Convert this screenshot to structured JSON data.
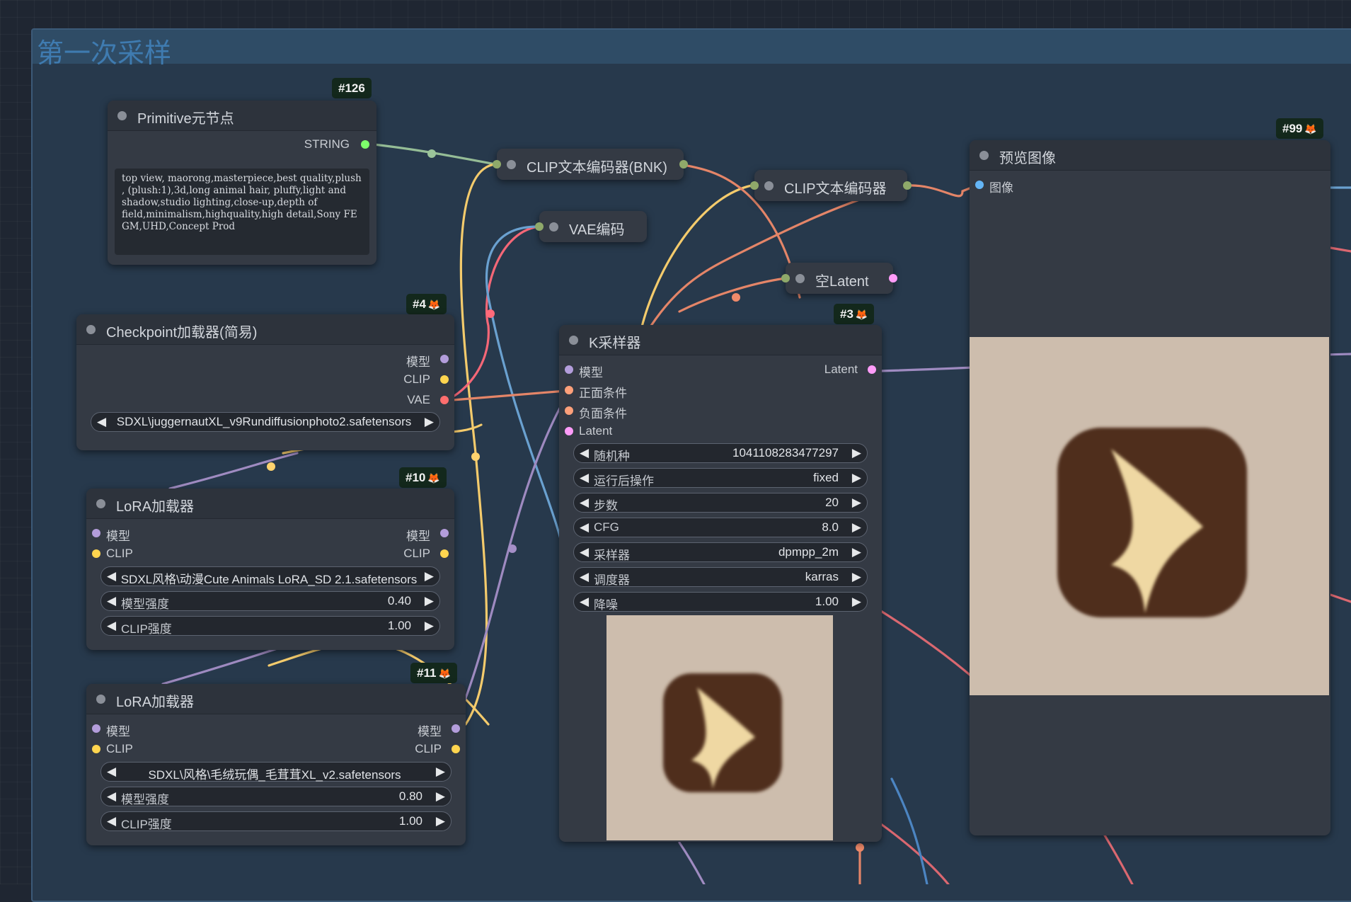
{
  "group": {
    "title": "第一次采样"
  },
  "colors": {
    "model": "#b39ddb",
    "clip": "#ffd54f",
    "vae": "#ff6e6e",
    "conditioning": "#ffa07a",
    "latent": "#ff9cf9",
    "image": "#64b5f6",
    "string": "#7dff6b",
    "badge_bg": "#13281c"
  },
  "nodes": {
    "primitive": {
      "badge": "#126",
      "title": "Primitive元节点",
      "output_label": "STRING",
      "text": "top view, maorong,masterpiece,best quality,plush , (plush:1),3d,long animal hair, pluffy,light and shadow,studio lighting,close-up,depth of field,minimalism,highquality,high detail,Sony FE GM,UHD,Concept Prod"
    },
    "clip_bnk": {
      "title": "CLIP文本编码器(BNK)"
    },
    "clip_encoder": {
      "title": "CLIP文本编码器"
    },
    "vae_encode": {
      "title": "VAE编码"
    },
    "empty_latent": {
      "title": "空Latent"
    },
    "checkpoint": {
      "badge": "#4",
      "title": "Checkpoint加载器(简易)",
      "outputs": [
        "模型",
        "CLIP",
        "VAE"
      ],
      "ckpt_value": "SDXL\\juggernautXL_v9Rundiffusionphoto2.safetensors"
    },
    "lora1": {
      "badge": "#10",
      "title": "LoRA加载器",
      "inputs": [
        "模型",
        "CLIP"
      ],
      "outputs": [
        "模型",
        "CLIP"
      ],
      "lora_value": "SDXL风格\\动漫Cute Animals LoRA_SD 2.1.safetensors",
      "model_strength_label": "模型强度",
      "model_strength": "0.40",
      "clip_strength_label": "CLIP强度",
      "clip_strength": "1.00"
    },
    "lora2": {
      "badge": "#11",
      "title": "LoRA加载器",
      "inputs": [
        "模型",
        "CLIP"
      ],
      "outputs": [
        "模型",
        "CLIP"
      ],
      "lora_value": "SDXL\\风格\\毛绒玩偶_毛茸茸XL_v2.safetensors",
      "model_strength_label": "模型强度",
      "model_strength": "0.80",
      "clip_strength_label": "CLIP强度",
      "clip_strength": "1.00"
    },
    "ksampler": {
      "badge": "#3",
      "title": "K采样器",
      "inputs": [
        "模型",
        "正面条件",
        "负面条件",
        "Latent"
      ],
      "output_label": "Latent",
      "widgets": [
        {
          "name": "随机种",
          "value": "1041108283477297"
        },
        {
          "name": "运行后操作",
          "value": "fixed"
        },
        {
          "name": "步数",
          "value": "20"
        },
        {
          "name": "CFG",
          "value": "8.0"
        },
        {
          "name": "采样器",
          "value": "dpmpp_2m"
        },
        {
          "name": "调度器",
          "value": "karras"
        },
        {
          "name": "降噪",
          "value": "1.00"
        }
      ]
    },
    "preview": {
      "badge": "#99",
      "title": "预览图像",
      "input_label": "图像"
    }
  }
}
